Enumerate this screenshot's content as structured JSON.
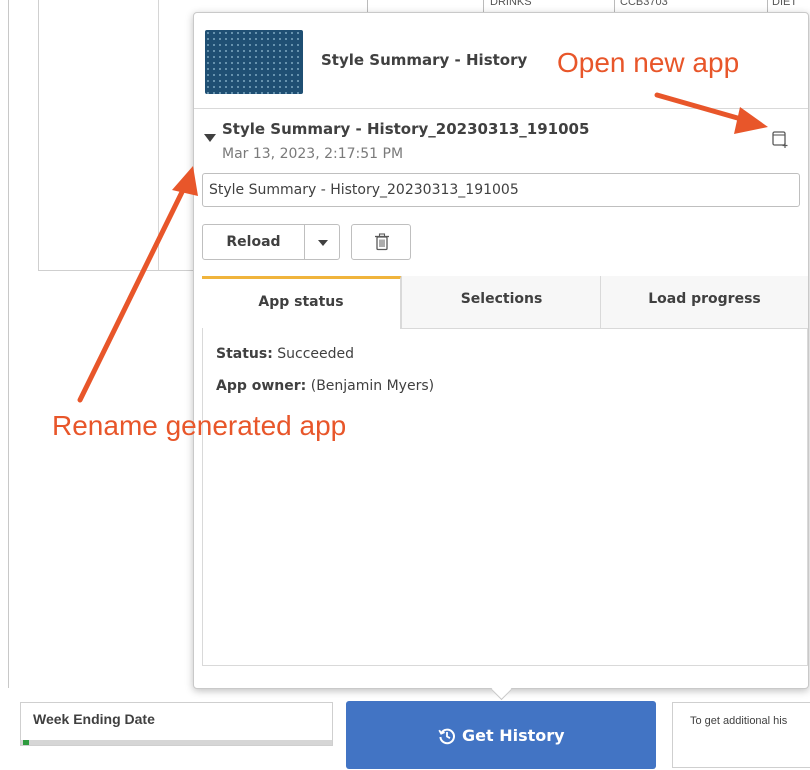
{
  "background": {
    "table_headers": [
      "DRINKS",
      "CCB3703",
      "DIET"
    ]
  },
  "popover": {
    "title": "Style Summary - History",
    "generated": {
      "name": "Style Summary - History_20230313_191005",
      "date": "Mar 13, 2023, 2:17:51 PM",
      "name_input_value": "Style Summary - History_20230313_191005",
      "open_icon": "open-new-app-icon"
    },
    "actions": {
      "reload_label": "Reload",
      "dropdown_icon": "chevron-down-icon",
      "delete_icon": "trash-icon"
    },
    "tabs": [
      {
        "label": "App status",
        "active": true
      },
      {
        "label": "Selections",
        "active": false
      },
      {
        "label": "Load progress",
        "active": false
      }
    ],
    "status": {
      "status_label": "Status:",
      "status_value": "Succeeded",
      "owner_label": "App owner:",
      "owner_value": "(Benjamin Myers)"
    }
  },
  "bottom": {
    "week_label": "Week Ending Date",
    "get_history_label": "Get History",
    "get_history_icon": "history-icon",
    "hint_text": "To get additional his"
  },
  "annotations": {
    "open_new_app": "Open new app",
    "rename_generated": "Rename generated app"
  },
  "colors": {
    "annotation": "#e8562a",
    "primary_button": "#4274c4",
    "active_tab_accent": "#f0b43c",
    "progress_green": "#2e9b3e"
  }
}
